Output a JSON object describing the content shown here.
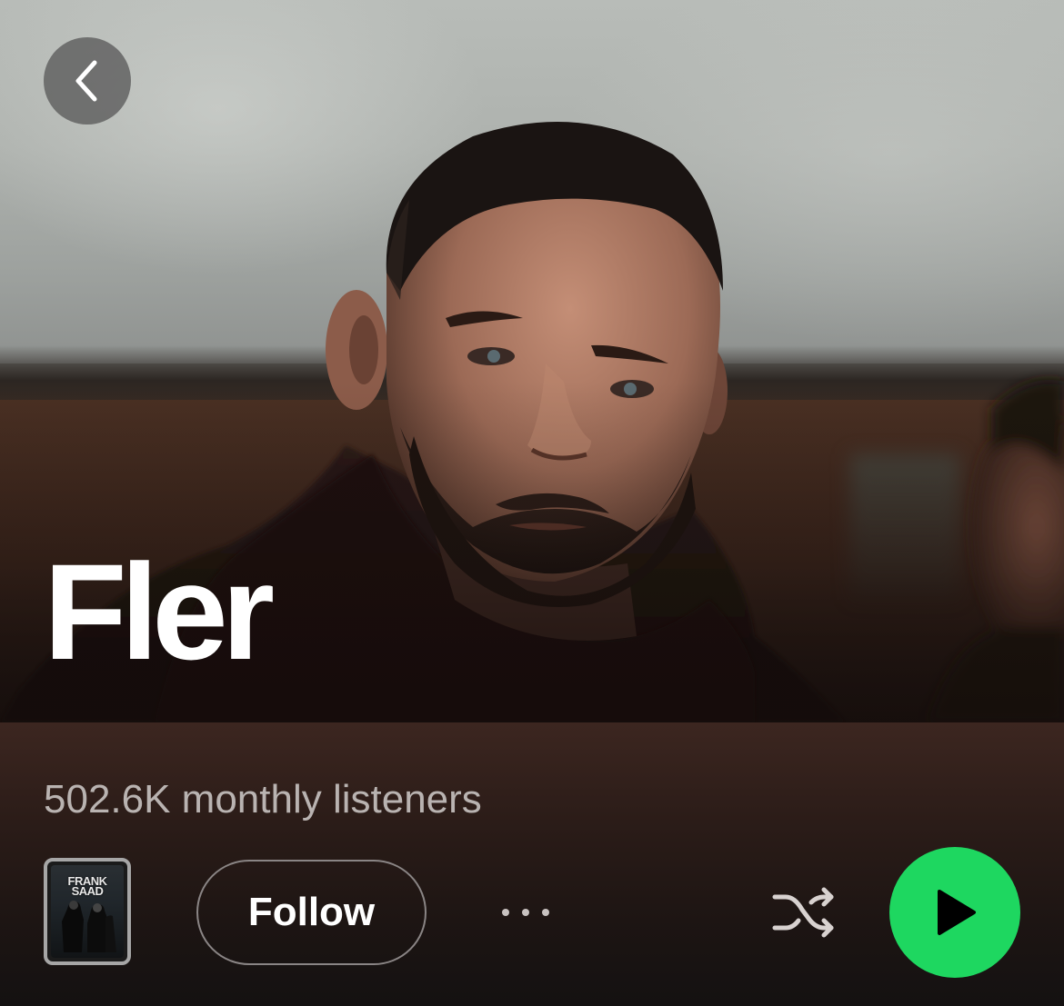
{
  "artist": {
    "name": "Fler",
    "monthly_listeners": "502.6K monthly listeners"
  },
  "header": {
    "back_icon": "chevron-left-icon"
  },
  "actions": {
    "follow_label": "Follow",
    "more_icon": "more-horizontal-icon",
    "shuffle_icon": "shuffle-icon",
    "play_icon": "play-icon"
  },
  "featured_release": {
    "cover_text_line1": "FRANK",
    "cover_text_line2": "SAAD"
  },
  "colors": {
    "play_button": "#1ed760",
    "text_primary": "#ffffff",
    "text_secondary": "#b9b3b1",
    "panel_background": "#2b1c18"
  }
}
